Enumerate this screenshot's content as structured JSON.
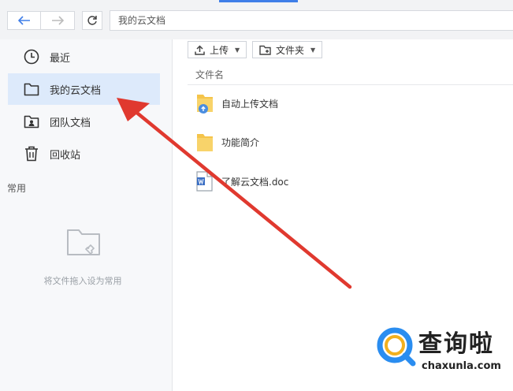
{
  "address_bar": {
    "path": "我的云文档"
  },
  "toolbar": {
    "upload_label": "上传",
    "folder_label": "文件夹"
  },
  "sidebar": {
    "items": [
      {
        "label": "最近",
        "icon": "clock-icon"
      },
      {
        "label": "我的云文档",
        "icon": "folder-icon",
        "active": true
      },
      {
        "label": "团队文档",
        "icon": "team-folder-icon"
      },
      {
        "label": "回收站",
        "icon": "trash-icon"
      }
    ],
    "section_title": "常用",
    "empty_hint": "将文件拖入设为常用"
  },
  "file_list": {
    "column_header": "文件名",
    "files": [
      {
        "name": "自动上传文档",
        "type": "folder-upload"
      },
      {
        "name": "功能简介",
        "type": "folder"
      },
      {
        "name": "了解云文档.doc",
        "type": "word-doc"
      }
    ]
  },
  "watermark": {
    "brand": "查询啦",
    "domain": "chaxunla.com"
  },
  "colors": {
    "accent": "#3f7ee8",
    "active_bg": "#ddeafb",
    "arrow": "#e0392f",
    "folder": "#f5c44a"
  }
}
